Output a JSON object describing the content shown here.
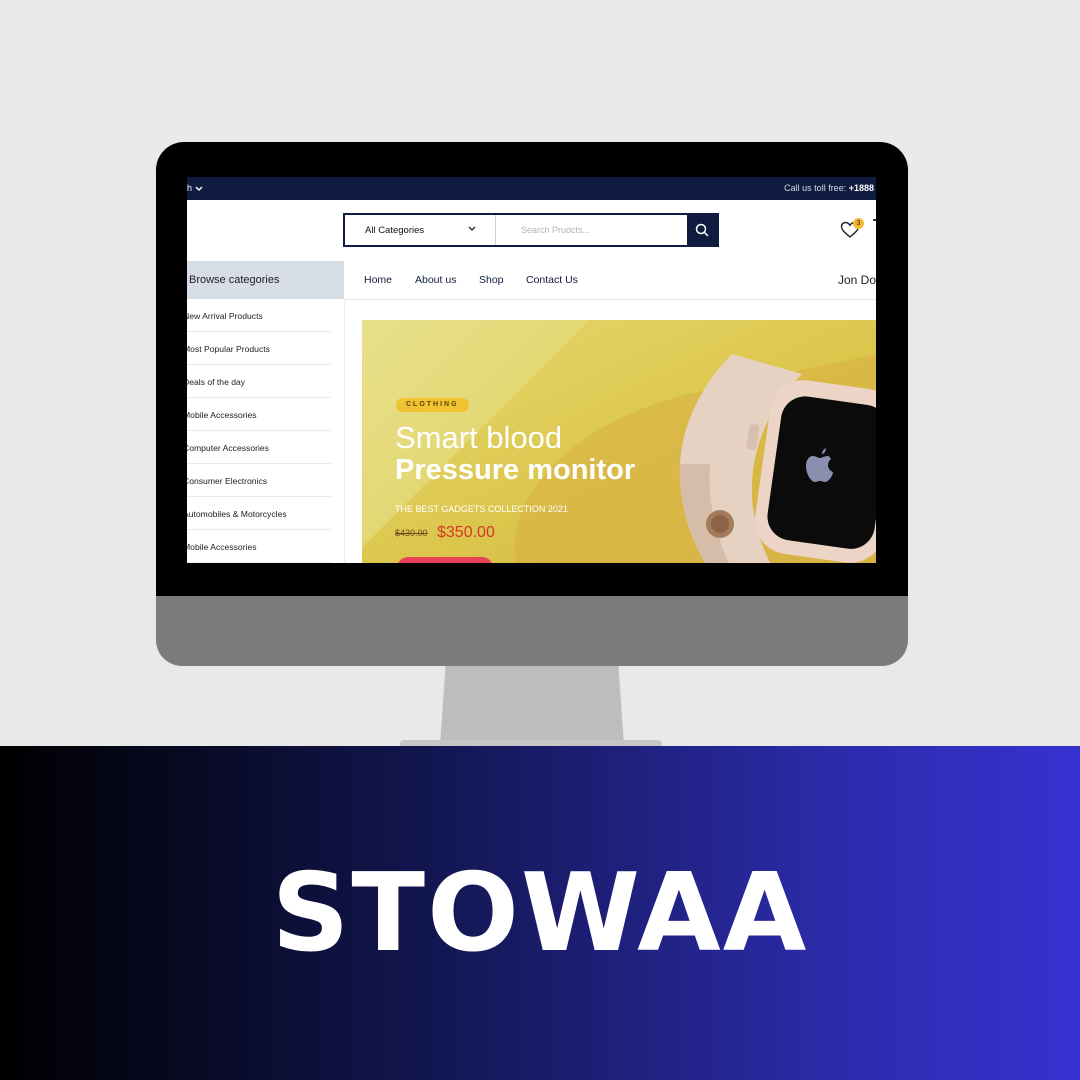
{
  "topbar": {
    "language_partial": "h",
    "tollfree_label": "Call us toll free:",
    "tollfree_number": "+1888"
  },
  "search": {
    "category": "All Categories",
    "placeholder": "Search Prudcts..."
  },
  "wishlist": {
    "count": "3"
  },
  "nav": {
    "browse_label": "Browse categories",
    "items": [
      "Home",
      "About us",
      "Shop",
      "Contact Us"
    ],
    "account": "Jon Do"
  },
  "categories": [
    "New Arrival Products",
    "Most Popular Products",
    "Deals of the day",
    "Mobile Accessories",
    "Computer Accessories",
    "Consumer Electronics",
    "Automobiles & Motorcycles",
    "Mobile Accessories"
  ],
  "banner": {
    "tag": "CLOTHING",
    "title_line1": "Smart blood",
    "title_line2": "Pressure monitor",
    "subtitle": "THE BEST GADGETS COLLECTION 2021",
    "old_price": "$430.00",
    "new_price": "$350.00"
  },
  "brand": "STOWAA",
  "colors": {
    "navy": "#0f1c3f",
    "accent_price": "#d7382a",
    "tag": "#f1c232",
    "band_end": "#3632d1"
  }
}
